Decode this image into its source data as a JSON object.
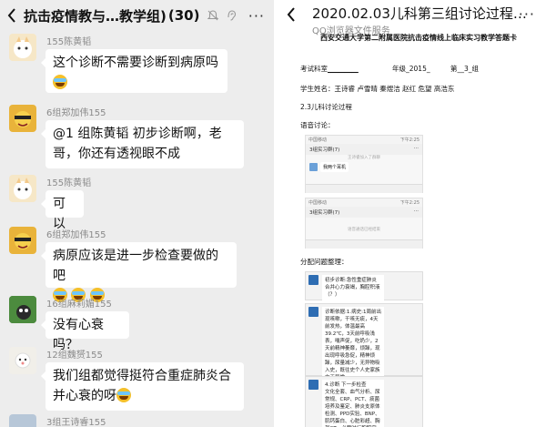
{
  "left": {
    "title": "抗击疫情教与…教学组)",
    "count": "(30)",
    "messages": [
      {
        "sender": "155陈黄韬",
        "text": "这个诊断不需要诊断到病原吗",
        "emoji": "tear"
      },
      {
        "sender": "6组郑加伟155",
        "text_line1": "@1 组陈黄韬   初步诊断啊，老",
        "text_line2": "哥，你还有透视眼不成"
      },
      {
        "sender": "155陈黄韬",
        "text": "可以"
      },
      {
        "sender": "6组郑加伟155",
        "text": "病原应该是进一步检查要做的吧",
        "emoji": "tear3"
      },
      {
        "sender": "16组麻莉媚155",
        "text": "没有心衰吗？"
      },
      {
        "sender": "12组魏赟155",
        "text_line1": "我们组都觉得挺符合重症肺炎合",
        "text_line2": "并心衰的呀",
        "emoji": "tear"
      },
      {
        "sender": "3组王诗睿155"
      }
    ]
  },
  "right": {
    "title": "2020.02.03儿科第三组讨论过程…",
    "subtitle": "QQ浏览器文件服务",
    "doc": {
      "heading": "西安交通大学第二附属医院抗击疫情线上临床实习教学答题卡",
      "line1_a": "考试科室",
      "line1_b": "_________",
      "line1_c": "年级_2015_",
      "line1_d": "第__3_组",
      "students": "学生姓名：王诗睿  卢雪晴  秦煜洁  赵红  危望  高浩东",
      "case": "2.3儿科讨论过程",
      "voice": "语音讨论：",
      "shot1": {
        "status_left": "中国移动",
        "status_right": "下午2:25",
        "nav": "3组实习群(7)",
        "sys": "王诗睿加入了群聊",
        "msg": "我两个耳机"
      },
      "shot2": {
        "status_left": "中国移动",
        "status_right": "下午2:25",
        "nav": "3组实习群(7)",
        "sys": "语音通话已经结束"
      },
      "assign": "分配问题整理：",
      "note1": "初步诊断:急性重症肺炎合并心力衰竭，胸腔积液（？）",
      "note2": "诊断依据:1.病史:1周前出现咳嗽，干咳无痰，4天前发热，体温最高39.2℃，3天前呼吸浅表，喘声促，吃奶少，2天前精神萎靡，烦躁，现出现呼吸急促，精神烦躁，尿量减少，无异物吸入史，既往史个人史家族史无异常",
      "note3": "4.诊断 下一步检查\n文化全套、血气分析、尿常规、CRP、PCT、痰菌培养及鉴定、肺炎支原体检测、PPD实验、BNP、肌钙蛋白、心脏彩超、胸部CT，必要时行胸腔穿刺及胸腔镜"
    }
  }
}
